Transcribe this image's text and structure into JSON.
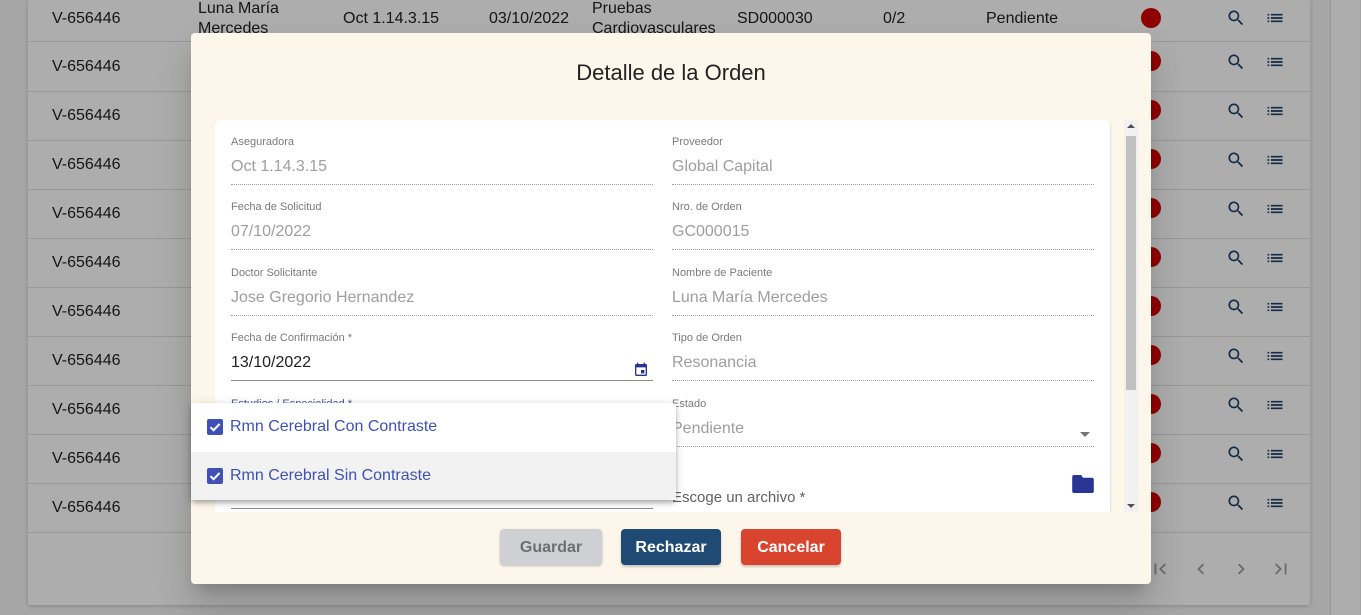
{
  "table": {
    "first_row": {
      "code": "V-656446",
      "patient": "Luna María Mercedes",
      "insurer": "Oct 1.14.3.15",
      "date": "03/10/2022",
      "type": "Pruebas Cardiovasculares",
      "order": "SD000030",
      "progress": "0/2",
      "status": "Pendiente"
    },
    "other_rows": [
      "V-656446",
      "V-656446",
      "V-656446",
      "V-656446",
      "V-656446",
      "V-656446",
      "V-656446",
      "V-656446",
      "V-656446",
      "V-656446"
    ],
    "status_color": "#d50000",
    "row_icons": [
      "search-icon",
      "list-icon"
    ]
  },
  "dialog": {
    "title": "Detalle de la Orden",
    "fields": {
      "aseguradora": {
        "label": "Aseguradora",
        "value": "Oct 1.14.3.15"
      },
      "proveedor": {
        "label": "Proveedor",
        "value": "Global Capital"
      },
      "fecha_solicitud": {
        "label": "Fecha de Solicitud",
        "value": "07/10/2022"
      },
      "nro_orden": {
        "label": "Nro. de Orden",
        "value": "GC000015"
      },
      "doctor": {
        "label": "Doctor Solicitante",
        "value": "Jose Gregorio Hernandez"
      },
      "paciente": {
        "label": "Nombre de Paciente",
        "value": "Luna María Mercedes"
      },
      "fecha_confirmacion": {
        "label": "Fecha de Confirmación *",
        "value": "13/10/2022"
      },
      "tipo_orden": {
        "label": "Tipo de Orden",
        "value": "Resonancia"
      },
      "estudios": {
        "label": "Estudios / Especialidad *"
      },
      "estado": {
        "label": "Estado",
        "value": "Pendiente"
      },
      "archivo": {
        "placeholder": "Escoge un archivo *"
      }
    },
    "buttons": {
      "save": "Guardar",
      "reject": "Rechazar",
      "cancel": "Cancelar"
    },
    "colors": {
      "background": "#fdf6eb",
      "reject": "#1e4a74",
      "cancel": "#d9442f",
      "save_disabled": "#cfd0d4",
      "accent": "#3f51b5"
    }
  },
  "dropdown": {
    "options": [
      {
        "label": "Rmn Cerebral Con Contraste",
        "checked": true
      },
      {
        "label": "Rmn Cerebral Sin Contraste",
        "checked": true
      }
    ]
  }
}
